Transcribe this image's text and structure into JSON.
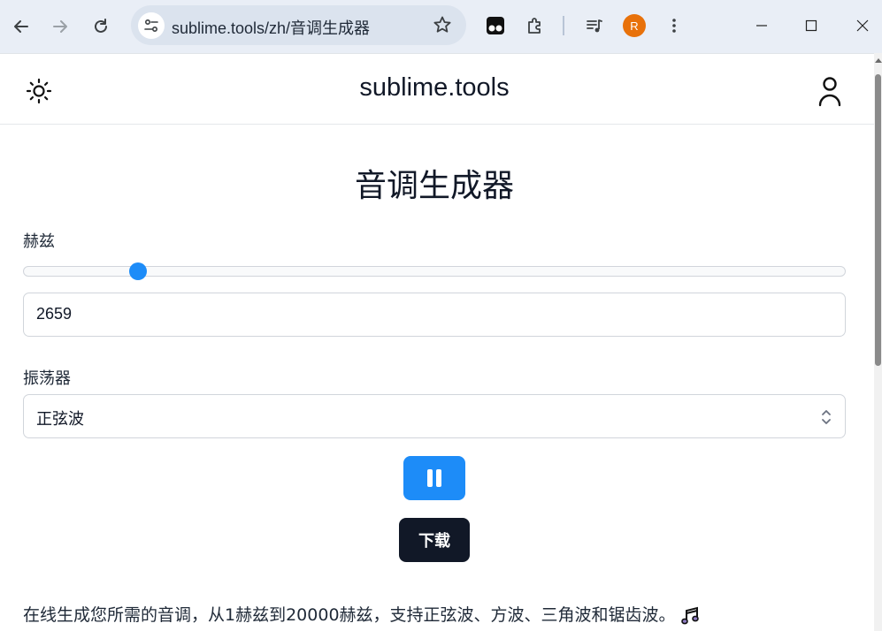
{
  "browser": {
    "url": "sublime.tools/zh/音调生成器",
    "profile_initial": "R",
    "profile_color": "#e8710a"
  },
  "site": {
    "brand": "sublime.tools"
  },
  "tool": {
    "title": "音调生成器",
    "hz_label": "赫兹",
    "hz_value": "2659",
    "slider_fraction": 0.14,
    "oscillator_label": "振荡器",
    "oscillator_selected": "正弦波",
    "download_label": "下载",
    "description": "在线生成您所需的音调，从1赫兹到20000赫兹，支持正弦波、方波、三角波和锯齿波。",
    "accent_color": "#1d8cf8"
  }
}
